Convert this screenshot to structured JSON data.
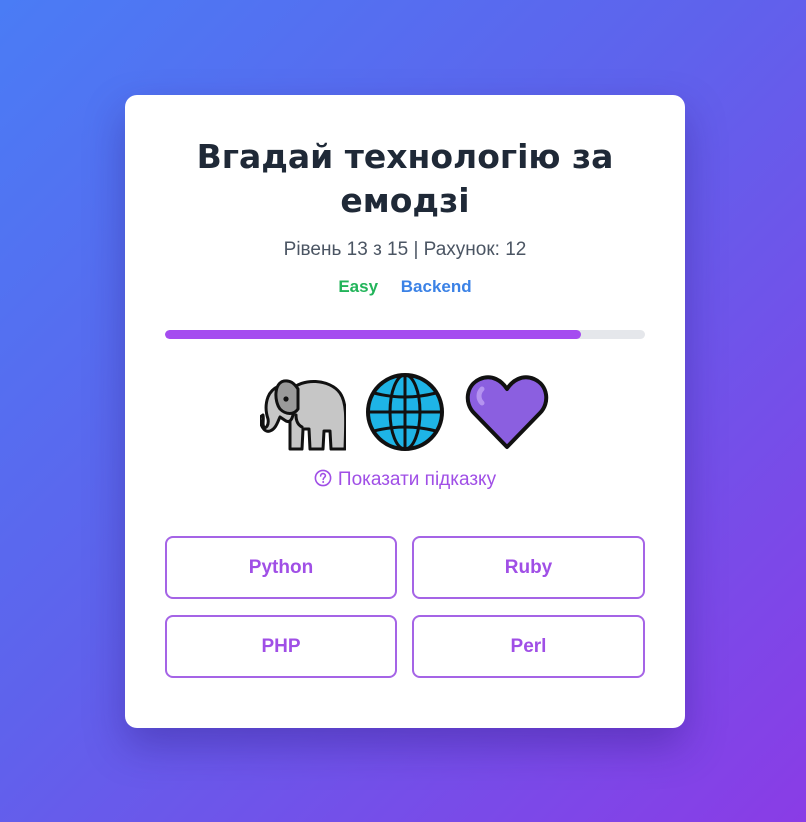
{
  "quiz": {
    "title": "Вгадай технологію за емодзі",
    "status": "Рівень 13 з 15 | Рахунок: 12",
    "level_current": 13,
    "level_total": 15,
    "score": 12,
    "tags": {
      "difficulty": "Easy",
      "category": "Backend"
    },
    "progress_fraction": 0.867,
    "emojis": [
      "elephant-emoji",
      "globe-with-meridians-emoji",
      "purple-heart-emoji"
    ],
    "hint_label": "Показати підказку",
    "options": [
      "Python",
      "Ruby",
      "PHP",
      "Perl"
    ]
  },
  "colors": {
    "accent": "#a54cf0",
    "difficulty_easy": "#22b45a",
    "category": "#3b82e6",
    "background_start": "#4a7cf5",
    "background_end": "#8a3ce6"
  }
}
